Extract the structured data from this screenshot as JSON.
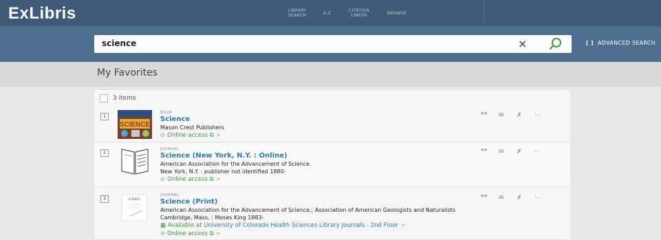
{
  "header": {
    "logo": "ExLibris",
    "nav": [
      {
        "label": "LIBRARY\nSEARCH"
      },
      {
        "label": "A-Z"
      },
      {
        "label": "CITATION\nLINKER"
      },
      {
        "label": "BROWSE"
      }
    ]
  },
  "search": {
    "query": "science",
    "clear_icon": "×",
    "advanced_label": "ADVANCED SEARCH",
    "advanced_bracket": "[ ]"
  },
  "favorites": {
    "title": "My Favorites",
    "count_label": "3 items"
  },
  "results": [
    {
      "number": "1",
      "type": "BOOK",
      "title": "Science",
      "lines": [
        "Mason Crest Publishers"
      ],
      "online": "Online access"
    },
    {
      "number": "2",
      "type": "JOURNAL",
      "title": "Science (New York, N.Y. : Online)",
      "lines": [
        "American Association for the Advancement of Science.",
        "New York, N.Y. : publisher not identified 1880-"
      ],
      "online": "Online access"
    },
    {
      "number": "3",
      "type": "JOURNAL",
      "title": "Science (Print)",
      "lines": [
        "American Association for the Advancement of Science.; Association of American Geologists and Naturalists",
        "Cambridge, Mass. : Moses King 1883-"
      ],
      "available_prefix": "Available at",
      "available_location": "University of Colorado Health Sciences Library Journals - 2nd Floor",
      "online": "Online access",
      "thumb_text": "SCIENCE"
    }
  ],
  "thumb1_text": "SCIENCE",
  "actions": {
    "cite": "❞❞",
    "email": "✉",
    "pin": "✗",
    "more": "···"
  },
  "colors": {
    "topbar": "#3e5a78",
    "searchbar": "#4d6e8f",
    "title_link": "#2a7ab3",
    "online_green": "#3b9a3b"
  }
}
